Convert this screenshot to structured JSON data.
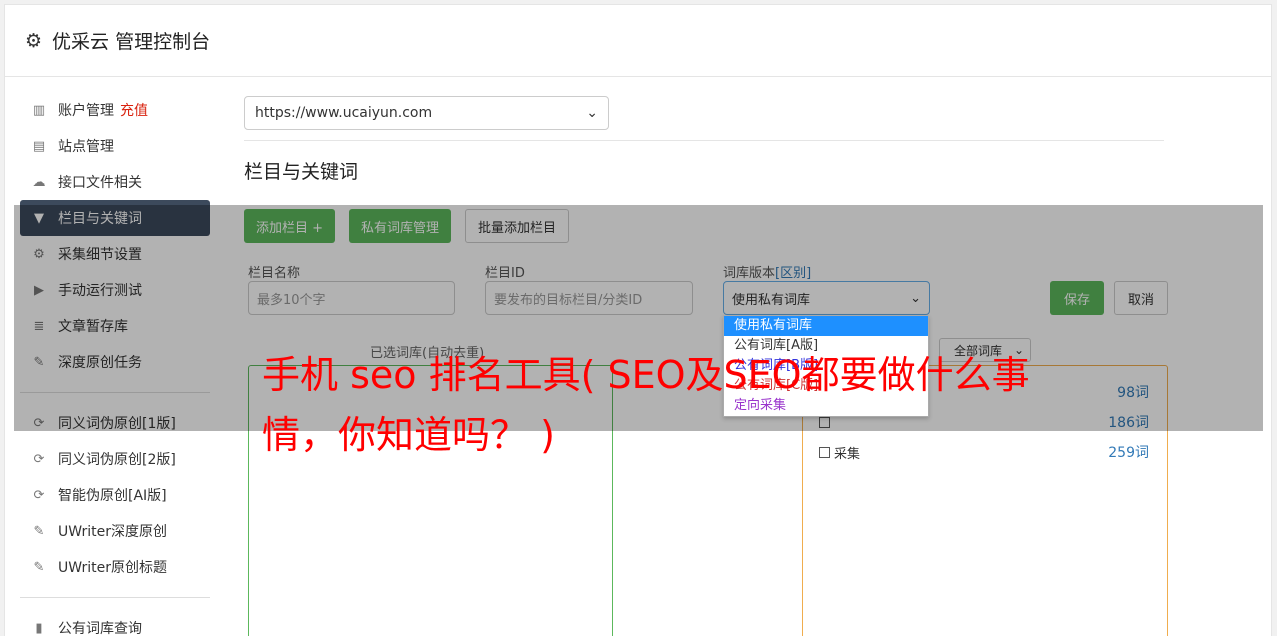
{
  "header": {
    "title": "优采云 管理控制台",
    "icon": "gear-icon"
  },
  "sidebar": {
    "items": [
      {
        "label": "账户管理",
        "badge": "充值",
        "icon": "bar-chart-icon"
      },
      {
        "label": "站点管理",
        "icon": "server-icon"
      },
      {
        "label": "接口文件相关",
        "icon": "cloud-upload-icon"
      },
      {
        "label": "栏目与关键词",
        "icon": "filter-icon",
        "active": true
      },
      {
        "label": "采集细节设置",
        "icon": "cogs-icon"
      },
      {
        "label": "手动运行测试",
        "icon": "play-icon"
      },
      {
        "label": "文章暂存库",
        "icon": "database-icon"
      },
      {
        "label": "深度原创任务",
        "icon": "edit-icon"
      },
      {
        "label": "同义词伪原创[1版]",
        "icon": "refresh-icon"
      },
      {
        "label": "同义词伪原创[2版]",
        "icon": "refresh-icon"
      },
      {
        "label": "智能伪原创[AI版]",
        "icon": "refresh-icon"
      },
      {
        "label": "UWriter深度原创",
        "icon": "edit-icon"
      },
      {
        "label": "UWriter原创标题",
        "icon": "edit-icon"
      },
      {
        "label": "公有词库查询",
        "icon": "book-icon"
      }
    ]
  },
  "main": {
    "site_select_value": "https://www.ucaiyun.com",
    "section_title": "栏目与关键词",
    "buttons": {
      "add_column": "添加栏目 +",
      "private_lib": "私有词库管理",
      "batch_add": "批量添加栏目"
    },
    "fields": {
      "column_name_label": "栏目名称",
      "column_name_placeholder": "最多10个字",
      "column_id_label": "栏目ID",
      "column_id_placeholder": "要发布的目标栏目/分类ID",
      "lib_version_label": "词库版本",
      "lib_version_link": "[区别]",
      "lib_version_value": "使用私有词库"
    },
    "save_label": "保存",
    "cancel_label": "取消",
    "dropdown_options": [
      "使用私有词库",
      "公有词库[A版]",
      "公有词库[B版]",
      "公有词库[C版]",
      "定向采集"
    ],
    "selected_lib_label": "已选词库(自动去重)",
    "all_lib_select": "全部词库",
    "lib_list": [
      {
        "name": "",
        "count": "98词"
      },
      {
        "name": "",
        "count": "186词"
      },
      {
        "name": "采集",
        "count": "259词"
      }
    ]
  },
  "overlay_text": "手机 seo 排名工具( SEO及SEO都要做什么事情，你知道吗？ )",
  "colors": {
    "accent_green": "#5cb85c",
    "active_nav": "#3c4a5c",
    "recharge_red": "#d9230f",
    "link_blue": "#337ab7",
    "watermark_red": "#ff0000"
  }
}
